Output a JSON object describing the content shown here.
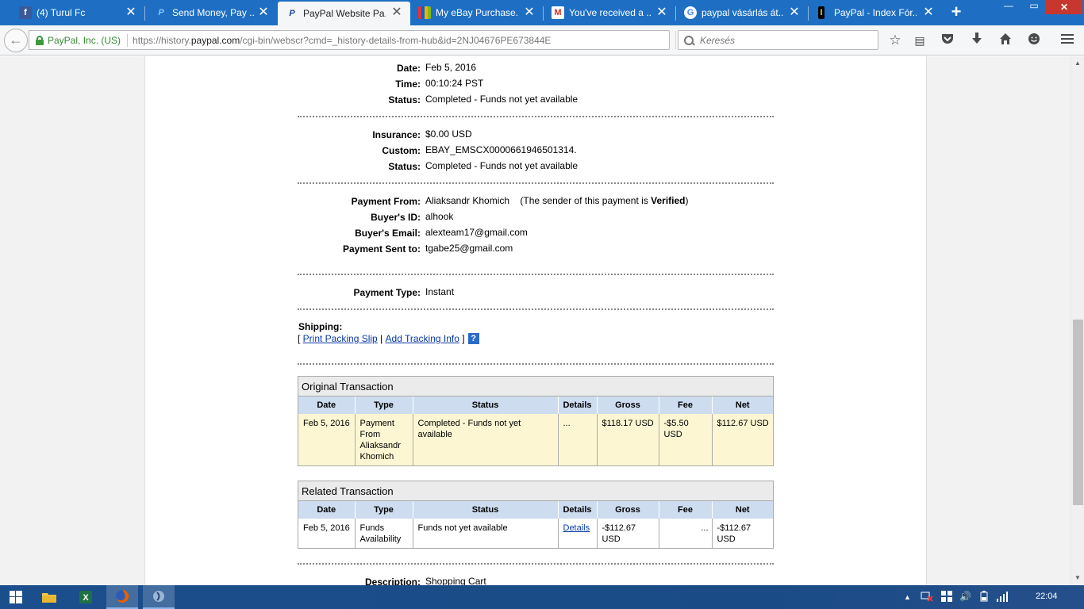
{
  "browser": {
    "tabs": [
      {
        "title": "(4) Turul Fc",
        "favicon": "facebook-icon",
        "fav_color": "#3b5998",
        "fav_glyph": "f"
      },
      {
        "title": "Send Money, Pay ...",
        "favicon": "paypal-icon",
        "fav_color": "#ffffff",
        "fav_glyph": "P"
      },
      {
        "title": "PayPal Website Pa...",
        "favicon": "paypal-icon",
        "fav_color": "#ffffff",
        "fav_glyph": "P",
        "active": true
      },
      {
        "title": "My eBay Purchase...",
        "favicon": "ebay-icon",
        "fav_color": "#ffffff",
        "fav_glyph": "e"
      },
      {
        "title": "You've received a ...",
        "favicon": "gmail-icon",
        "fav_color": "#ffffff",
        "fav_glyph": "M"
      },
      {
        "title": "paypal vásárlás át...",
        "favicon": "google-icon",
        "fav_color": "#ffffff",
        "fav_glyph": "G"
      },
      {
        "title": "PayPal - Index Fór...",
        "favicon": "index-icon",
        "fav_color": "#000000",
        "fav_glyph": "I"
      }
    ],
    "identity": "PayPal, Inc. (US)",
    "url_prefix": "https://history.",
    "url_domain": "paypal.com",
    "url_suffix": "/cgi-bin/webscr?cmd=_history-details-from-hub&id=2NJ04676PE673844E",
    "search_placeholder": "Keresés"
  },
  "details": {
    "date_label": "Date:",
    "date": "Feb 5, 2016",
    "time_label": "Time:",
    "time": "00:10:24 PST",
    "status_label": "Status:",
    "status": "Completed - Funds not yet available",
    "insurance_label": "Insurance:",
    "insurance": "$0.00 USD",
    "custom_label": "Custom:",
    "custom": "EBAY_EMSCX0000661946501314.",
    "status2_label": "Status:",
    "status2": "Completed - Funds not yet available",
    "payment_from_label": "Payment From:",
    "payment_from": "Aliaksandr Khomich",
    "verified_prefix": "(The sender of this payment is ",
    "verified_word": "Verified",
    "verified_suffix": ")",
    "buyer_id_label": "Buyer's ID:",
    "buyer_id": "alhook",
    "buyer_email_label": "Buyer's Email:",
    "buyer_email": "alexteam17@gmail.com",
    "sent_to_label": "Payment Sent to:",
    "sent_to": "tgabe25@gmail.com",
    "payment_type_label": "Payment Type:",
    "payment_type": "Instant",
    "shipping_label": "Shipping:",
    "print_slip": "Print Packing Slip",
    "add_tracking": "Add Tracking Info",
    "description_label": "Description:",
    "description": "Shopping Cart"
  },
  "original": {
    "caption": "Original Transaction",
    "headers": [
      "Date",
      "Type",
      "Status",
      "Details",
      "Gross",
      "Fee",
      "Net"
    ],
    "row": {
      "date": "Feb 5, 2016",
      "type": "Payment From Aliaksandr Khomich",
      "status": "Completed - Funds not yet available",
      "details": "...",
      "gross": "$118.17 USD",
      "fee": "-$5.50 USD",
      "net": "$112.67 USD"
    }
  },
  "related": {
    "caption": "Related Transaction",
    "headers": [
      "Date",
      "Type",
      "Status",
      "Details",
      "Gross",
      "Fee",
      "Net"
    ],
    "row": {
      "date": "Feb 5, 2016",
      "type": "Funds Availability",
      "status": "Funds not yet available",
      "details": "Details",
      "gross": "-$112.67 USD",
      "fee": "...",
      "net": "-$112.67 USD"
    }
  },
  "taskbar": {
    "clock": "22:04"
  }
}
